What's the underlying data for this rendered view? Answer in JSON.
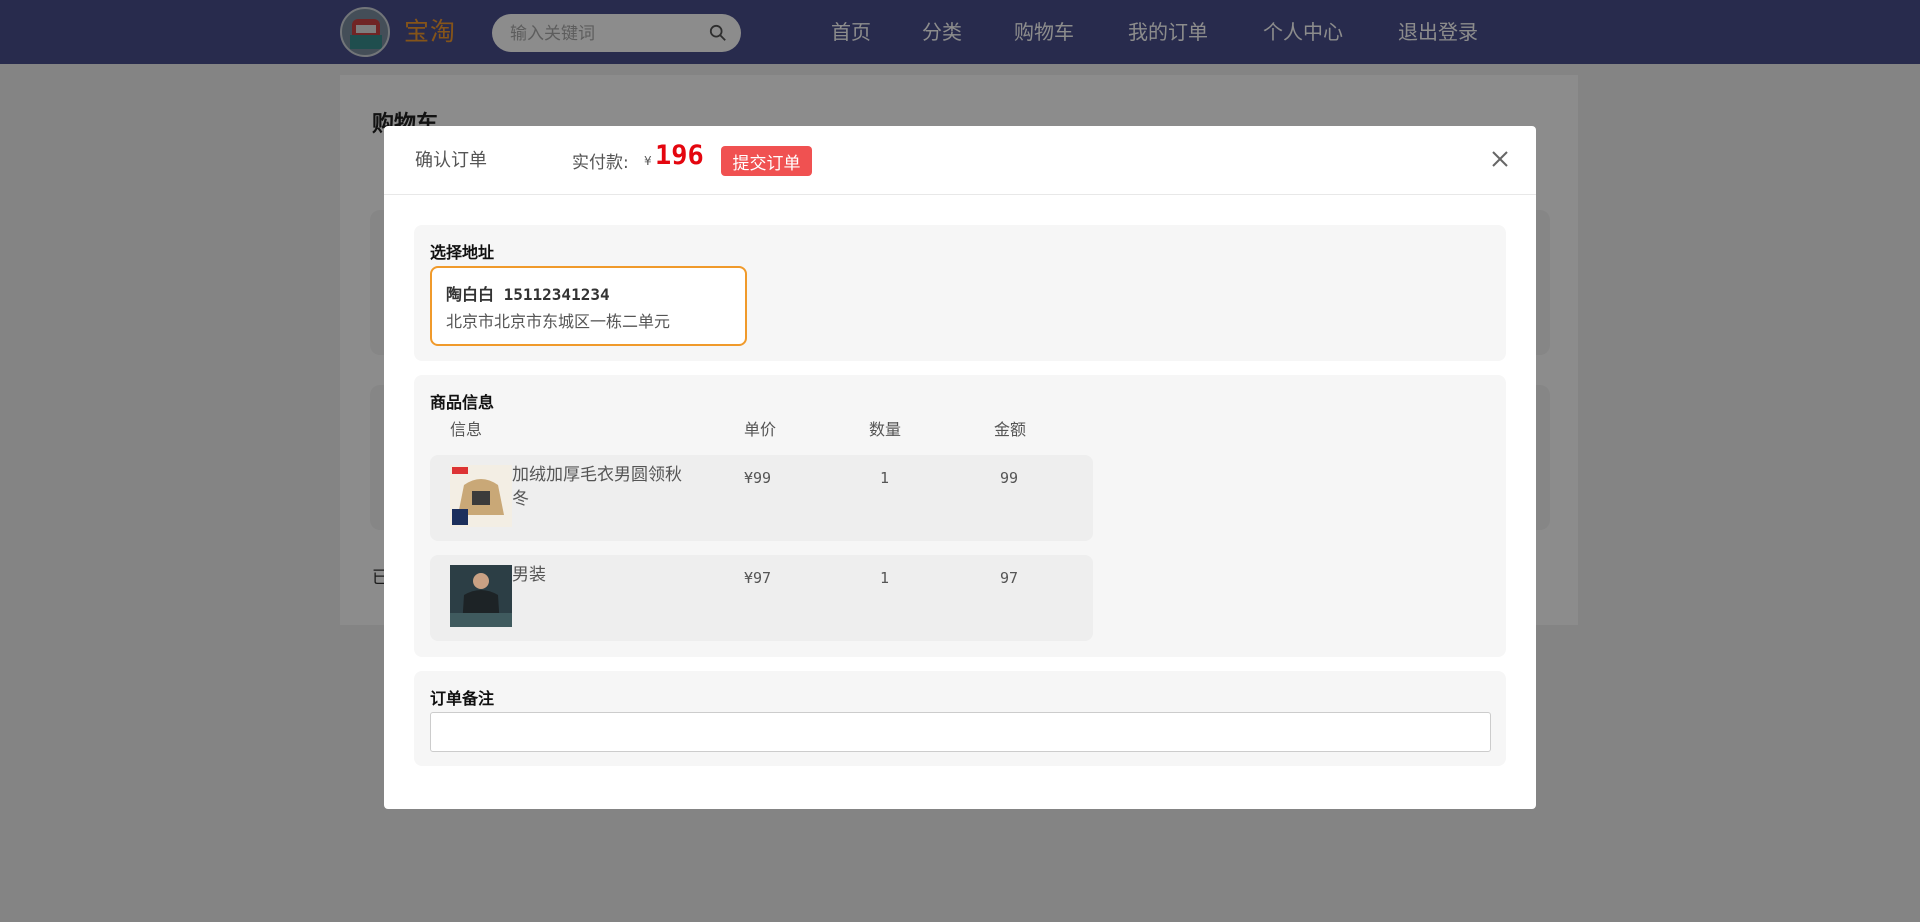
{
  "header": {
    "brand": "宝淘",
    "search_placeholder": "输入关键词",
    "nav": [
      "首页",
      "分类",
      "购物车",
      "我的订单",
      "个人中心",
      "退出登录"
    ]
  },
  "page": {
    "title": "购物车",
    "footer_text_partial": "已"
  },
  "modal": {
    "title": "确认订单",
    "pay_label": "实付款:",
    "currency": "¥",
    "pay_amount": "196",
    "submit_label": "提交订单",
    "address_section": {
      "title": "选择地址",
      "selected": {
        "name_phone": "陶白白 15112341234",
        "address": "北京市北京市东城区一栋二单元"
      }
    },
    "goods_section": {
      "title": "商品信息",
      "columns": [
        "信息",
        "单价",
        "数量",
        "金额"
      ],
      "items": [
        {
          "name": "加绒加厚毛衣男圆领秋冬",
          "price": "¥99",
          "qty": "1",
          "amount": "99"
        },
        {
          "name": "男装",
          "price": "¥97",
          "qty": "1",
          "amount": "97"
        }
      ]
    },
    "remark_section": {
      "title": "订单备注",
      "value": ""
    }
  },
  "colors": {
    "header_bg": "#4a4f8c",
    "brand": "#f39a2e",
    "accent_red": "#f05151",
    "price_red": "#e4060f",
    "address_border": "#f09a2b"
  }
}
